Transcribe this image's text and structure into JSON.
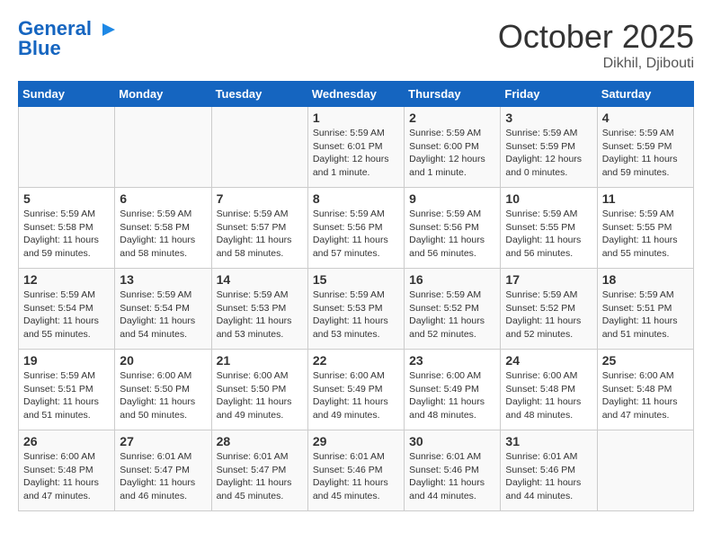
{
  "header": {
    "logo_line1": "General",
    "logo_line2": "Blue",
    "month_year": "October 2025",
    "location": "Dikhil, Djibouti"
  },
  "days_of_week": [
    "Sunday",
    "Monday",
    "Tuesday",
    "Wednesday",
    "Thursday",
    "Friday",
    "Saturday"
  ],
  "weeks": [
    [
      {
        "day": "",
        "content": ""
      },
      {
        "day": "",
        "content": ""
      },
      {
        "day": "",
        "content": ""
      },
      {
        "day": "1",
        "content": "Sunrise: 5:59 AM\nSunset: 6:01 PM\nDaylight: 12 hours\nand 1 minute."
      },
      {
        "day": "2",
        "content": "Sunrise: 5:59 AM\nSunset: 6:00 PM\nDaylight: 12 hours\nand 1 minute."
      },
      {
        "day": "3",
        "content": "Sunrise: 5:59 AM\nSunset: 5:59 PM\nDaylight: 12 hours\nand 0 minutes."
      },
      {
        "day": "4",
        "content": "Sunrise: 5:59 AM\nSunset: 5:59 PM\nDaylight: 11 hours\nand 59 minutes."
      }
    ],
    [
      {
        "day": "5",
        "content": "Sunrise: 5:59 AM\nSunset: 5:58 PM\nDaylight: 11 hours\nand 59 minutes."
      },
      {
        "day": "6",
        "content": "Sunrise: 5:59 AM\nSunset: 5:58 PM\nDaylight: 11 hours\nand 58 minutes."
      },
      {
        "day": "7",
        "content": "Sunrise: 5:59 AM\nSunset: 5:57 PM\nDaylight: 11 hours\nand 58 minutes."
      },
      {
        "day": "8",
        "content": "Sunrise: 5:59 AM\nSunset: 5:56 PM\nDaylight: 11 hours\nand 57 minutes."
      },
      {
        "day": "9",
        "content": "Sunrise: 5:59 AM\nSunset: 5:56 PM\nDaylight: 11 hours\nand 56 minutes."
      },
      {
        "day": "10",
        "content": "Sunrise: 5:59 AM\nSunset: 5:55 PM\nDaylight: 11 hours\nand 56 minutes."
      },
      {
        "day": "11",
        "content": "Sunrise: 5:59 AM\nSunset: 5:55 PM\nDaylight: 11 hours\nand 55 minutes."
      }
    ],
    [
      {
        "day": "12",
        "content": "Sunrise: 5:59 AM\nSunset: 5:54 PM\nDaylight: 11 hours\nand 55 minutes."
      },
      {
        "day": "13",
        "content": "Sunrise: 5:59 AM\nSunset: 5:54 PM\nDaylight: 11 hours\nand 54 minutes."
      },
      {
        "day": "14",
        "content": "Sunrise: 5:59 AM\nSunset: 5:53 PM\nDaylight: 11 hours\nand 53 minutes."
      },
      {
        "day": "15",
        "content": "Sunrise: 5:59 AM\nSunset: 5:53 PM\nDaylight: 11 hours\nand 53 minutes."
      },
      {
        "day": "16",
        "content": "Sunrise: 5:59 AM\nSunset: 5:52 PM\nDaylight: 11 hours\nand 52 minutes."
      },
      {
        "day": "17",
        "content": "Sunrise: 5:59 AM\nSunset: 5:52 PM\nDaylight: 11 hours\nand 52 minutes."
      },
      {
        "day": "18",
        "content": "Sunrise: 5:59 AM\nSunset: 5:51 PM\nDaylight: 11 hours\nand 51 minutes."
      }
    ],
    [
      {
        "day": "19",
        "content": "Sunrise: 5:59 AM\nSunset: 5:51 PM\nDaylight: 11 hours\nand 51 minutes."
      },
      {
        "day": "20",
        "content": "Sunrise: 6:00 AM\nSunset: 5:50 PM\nDaylight: 11 hours\nand 50 minutes."
      },
      {
        "day": "21",
        "content": "Sunrise: 6:00 AM\nSunset: 5:50 PM\nDaylight: 11 hours\nand 49 minutes."
      },
      {
        "day": "22",
        "content": "Sunrise: 6:00 AM\nSunset: 5:49 PM\nDaylight: 11 hours\nand 49 minutes."
      },
      {
        "day": "23",
        "content": "Sunrise: 6:00 AM\nSunset: 5:49 PM\nDaylight: 11 hours\nand 48 minutes."
      },
      {
        "day": "24",
        "content": "Sunrise: 6:00 AM\nSunset: 5:48 PM\nDaylight: 11 hours\nand 48 minutes."
      },
      {
        "day": "25",
        "content": "Sunrise: 6:00 AM\nSunset: 5:48 PM\nDaylight: 11 hours\nand 47 minutes."
      }
    ],
    [
      {
        "day": "26",
        "content": "Sunrise: 6:00 AM\nSunset: 5:48 PM\nDaylight: 11 hours\nand 47 minutes."
      },
      {
        "day": "27",
        "content": "Sunrise: 6:01 AM\nSunset: 5:47 PM\nDaylight: 11 hours\nand 46 minutes."
      },
      {
        "day": "28",
        "content": "Sunrise: 6:01 AM\nSunset: 5:47 PM\nDaylight: 11 hours\nand 45 minutes."
      },
      {
        "day": "29",
        "content": "Sunrise: 6:01 AM\nSunset: 5:46 PM\nDaylight: 11 hours\nand 45 minutes."
      },
      {
        "day": "30",
        "content": "Sunrise: 6:01 AM\nSunset: 5:46 PM\nDaylight: 11 hours\nand 44 minutes."
      },
      {
        "day": "31",
        "content": "Sunrise: 6:01 AM\nSunset: 5:46 PM\nDaylight: 11 hours\nand 44 minutes."
      },
      {
        "day": "",
        "content": ""
      }
    ]
  ]
}
